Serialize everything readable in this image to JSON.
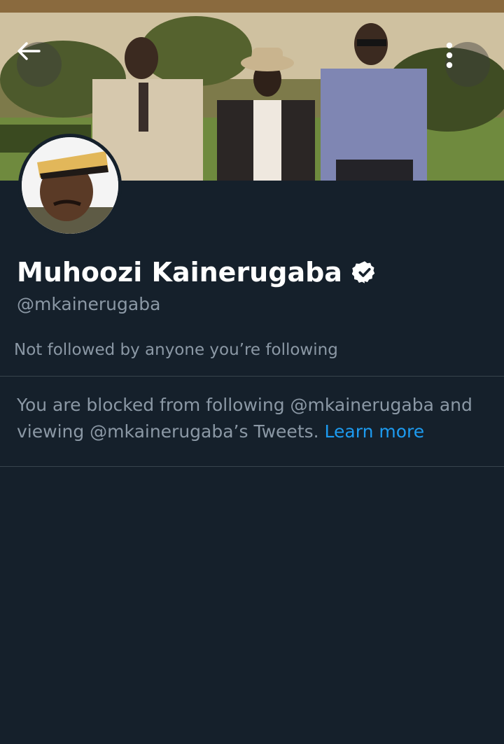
{
  "header": {
    "back_icon": "arrow-left-icon",
    "more_icon": "more-vertical-icon"
  },
  "profile": {
    "display_name": "Muhoozi Kainerugaba",
    "verified": true,
    "verified_icon": "verified-badge-icon",
    "handle": "@mkainerugaba",
    "followed_by_text": "Not followed by anyone you’re following"
  },
  "blocked_notice": {
    "text": "You are blocked from following @mkainerugaba and viewing @mkainerugaba’s Tweets.",
    "link_label": "Learn more"
  },
  "colors": {
    "background": "#15202b",
    "primary_text": "#ffffff",
    "secondary_text": "#8b98a5",
    "link": "#1d9bf0",
    "divider": "#38444d"
  }
}
